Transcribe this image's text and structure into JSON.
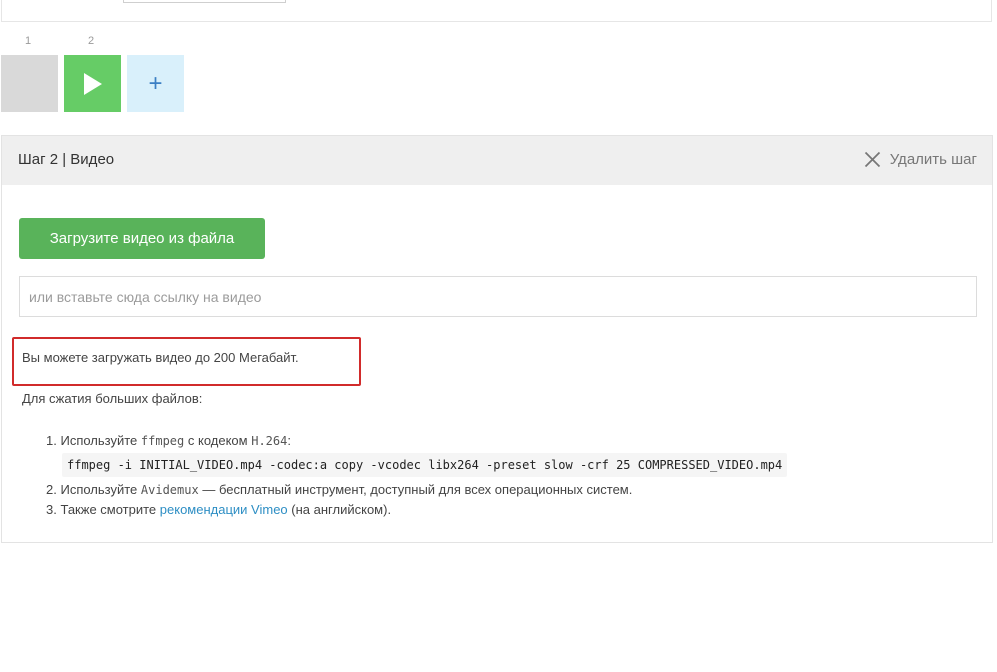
{
  "steps": {
    "numbers": [
      "1",
      "2"
    ],
    "add_label": "+"
  },
  "step_panel": {
    "title": "Шаг 2 | Видео",
    "delete_label": "Удалить шаг",
    "upload_button": "Загрузите видео из файла",
    "url_placeholder": "или вставьте сюда ссылку на видео",
    "size_limit": "Вы можете загружать видео до 200 Мегабайт.",
    "compress_intro": "Для сжатия больших файлов:",
    "tips": [
      {
        "num": "1.",
        "before": "Используйте",
        "tool": "ffmpeg",
        "middle": "с кодеком",
        "codec": "H.264",
        "after": ":",
        "command": "ffmpeg -i INITIAL_VIDEO.mp4 -codec:a copy -vcodec libx264 -preset slow -crf 25 COMPRESSED_VIDEO.mp4"
      },
      {
        "num": "2.",
        "before": "Используйте",
        "tool": "Avidemux",
        "after": "— бесплатный инструмент, доступный для всех операционных систем."
      },
      {
        "num": "3.",
        "before": "Также смотрите",
        "link": "рекомендации Vimeo",
        "after": "(на английском)."
      }
    ]
  },
  "colors": {
    "accent_green": "#59b35a",
    "play_tile": "#66cc66",
    "add_tile": "#d9f0fb",
    "highlight_red": "#d12b2b",
    "link": "#2d8ec4"
  },
  "icons": {
    "play": "play-icon",
    "add": "plus-icon",
    "delete": "close-icon"
  }
}
